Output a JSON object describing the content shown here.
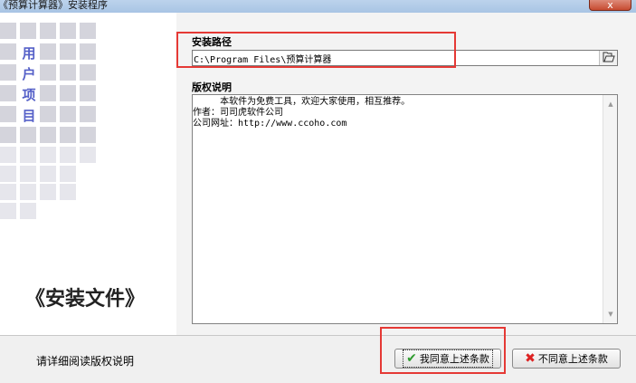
{
  "window": {
    "title": "《预算计算器》安装程序",
    "close_glyph": "x"
  },
  "left_panel": {
    "vertical_chars": [
      "用",
      "户",
      "项",
      "目"
    ],
    "big_title": "《安装文件》"
  },
  "install_path": {
    "label": "安装路径",
    "value": "C:\\Program Files\\预算计算器",
    "browse_icon": "folder-open-icon"
  },
  "license": {
    "label": "版权说明",
    "text": "     本软件为免费工具，欢迎大家使用，相互推荐。\n作者：司司虎软件公司\n公司网址：http://www.ccoho.com"
  },
  "footer": {
    "status_text": "请详细阅读版权说明",
    "agree_label": "我同意上述条款",
    "disagree_label": "不同意上述条款"
  },
  "colors": {
    "highlight_red": "#e53935",
    "accent_blue": "#5560c8",
    "agree_check": "#2e9b2e",
    "disagree_x": "#dd2222"
  }
}
